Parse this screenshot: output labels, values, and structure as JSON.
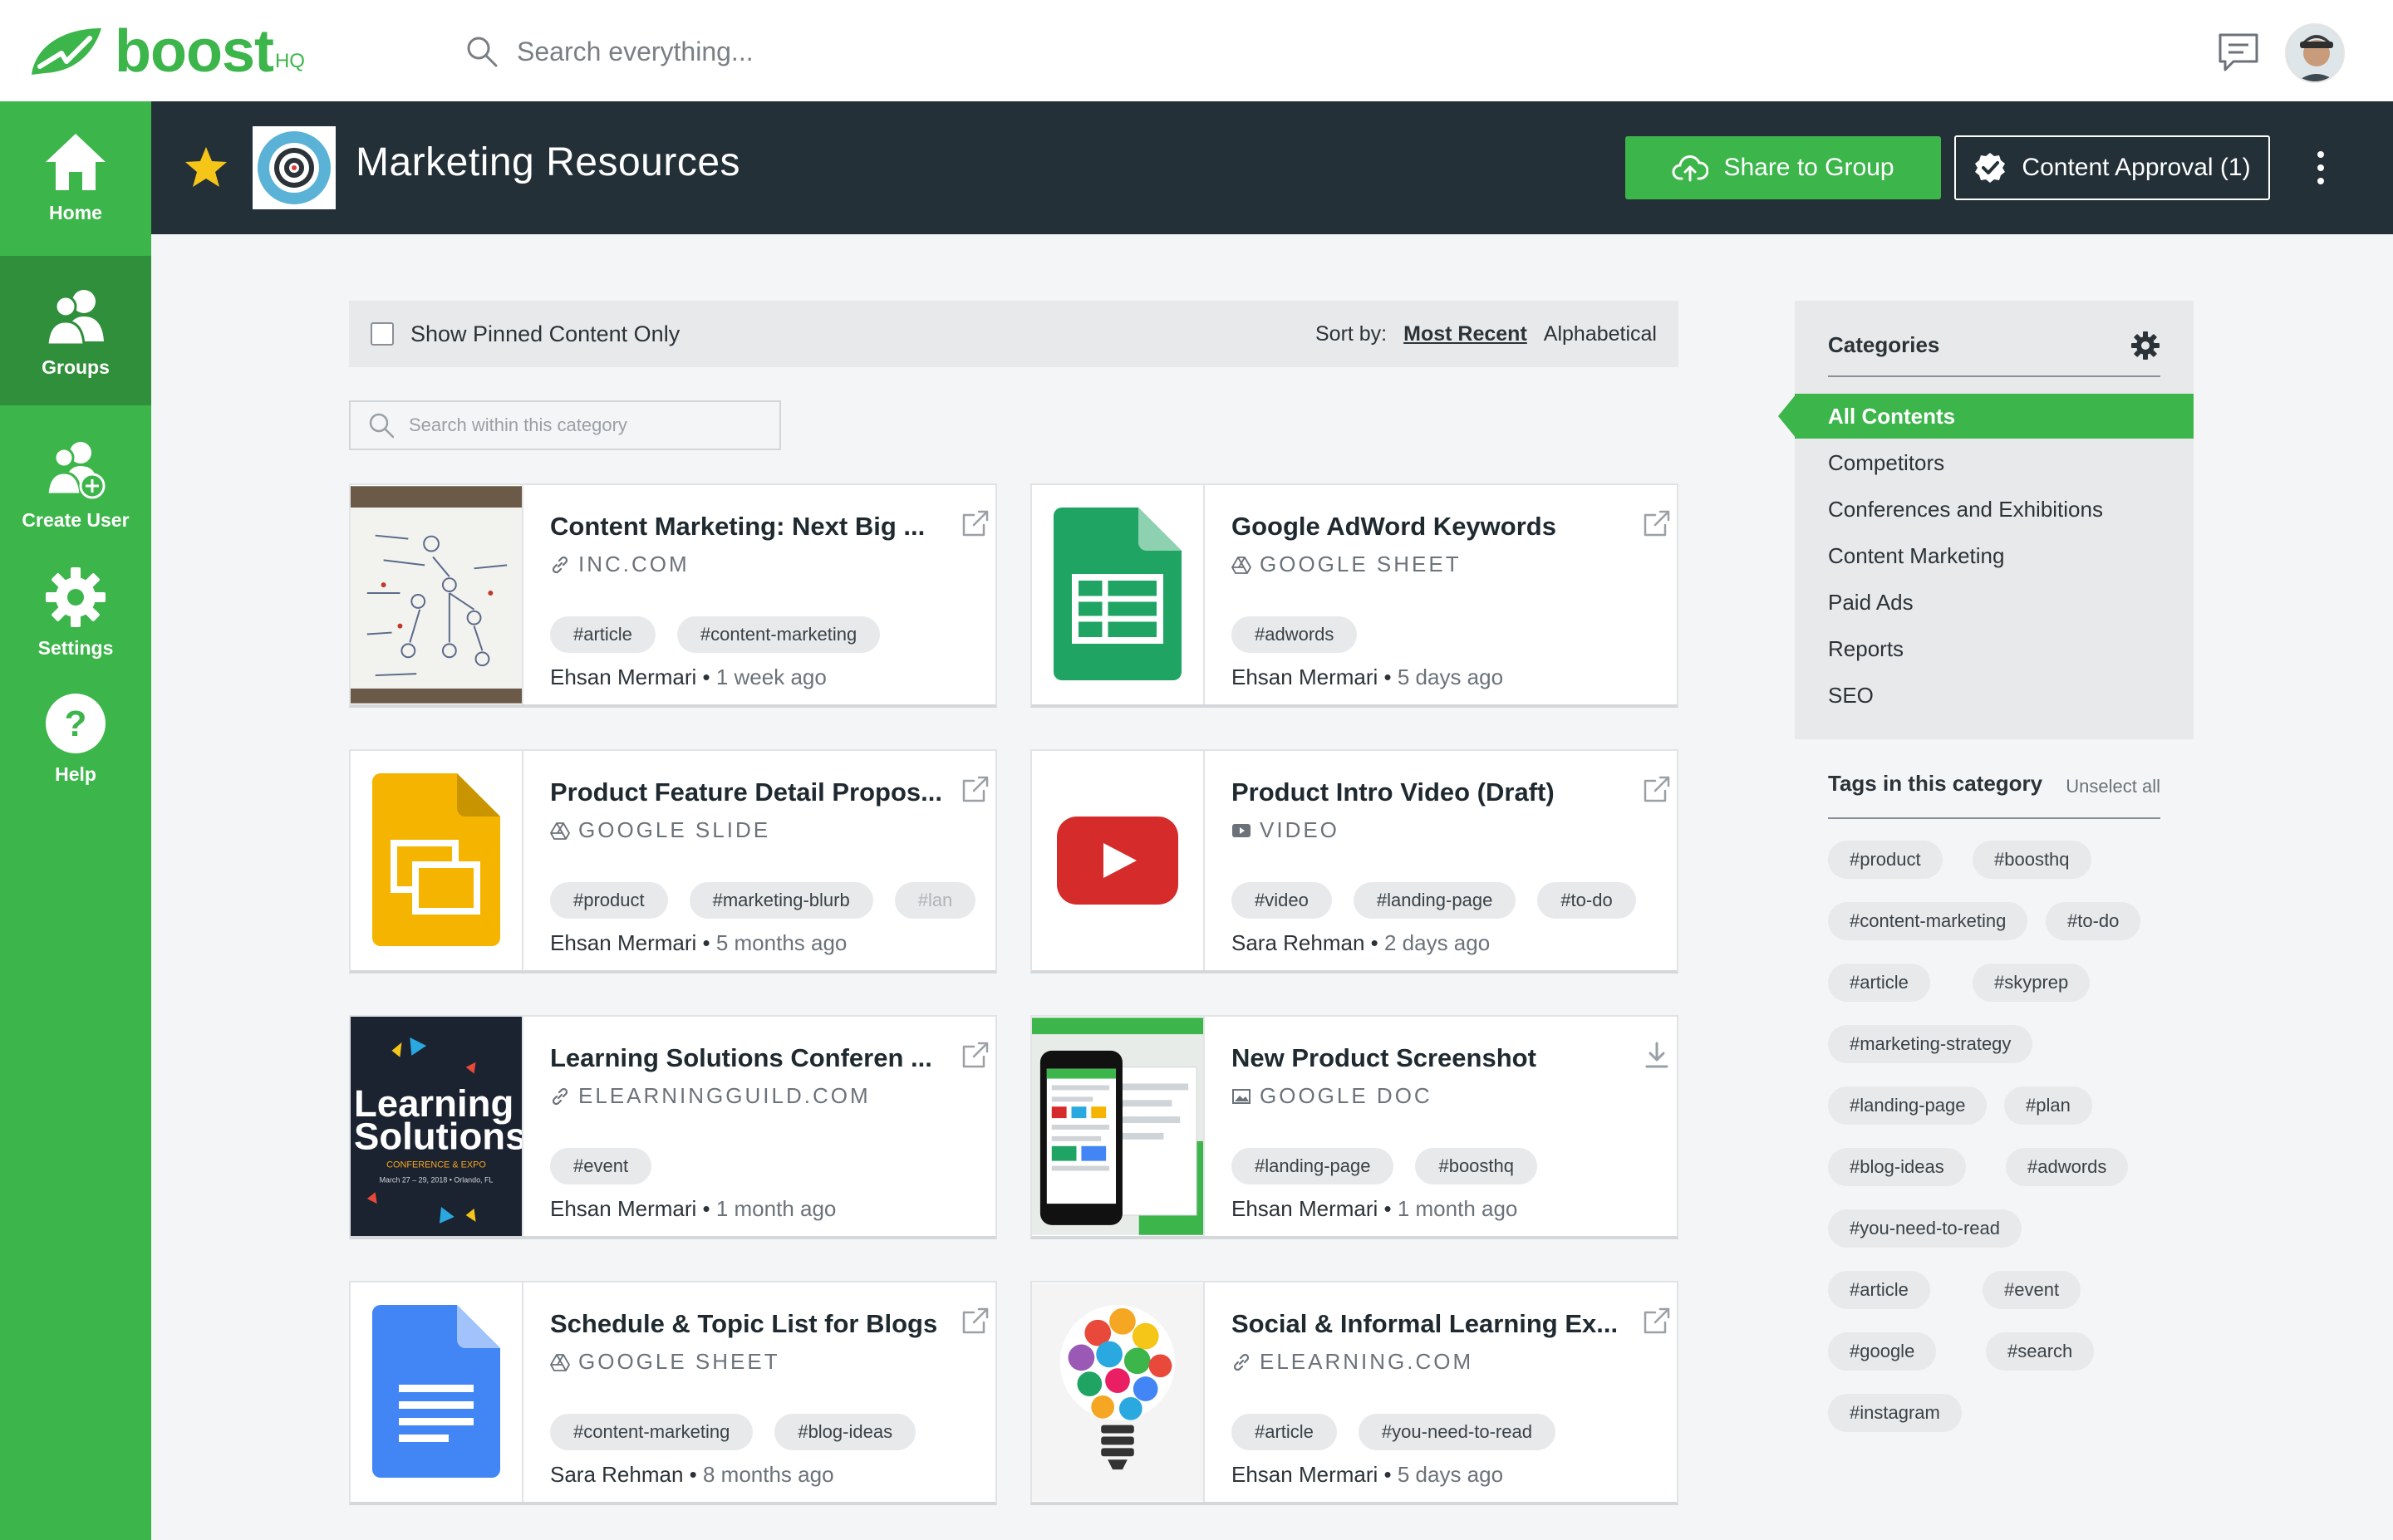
{
  "brand": {
    "name": "boost",
    "suffix": "HQ",
    "color": "#3cb54a"
  },
  "search": {
    "placeholder": "Search everything..."
  },
  "nav": {
    "home": "Home",
    "groups": "Groups",
    "create_user": "Create User",
    "settings": "Settings",
    "help": "Help"
  },
  "group": {
    "title": "Marketing Resources",
    "share_label": "Share to Group",
    "approval_label": "Content Approval (1)"
  },
  "filter": {
    "pinned_label": "Show Pinned Content Only",
    "sort_label": "Sort by:",
    "sort_recent": "Most Recent",
    "sort_alpha": "Alphabetical",
    "category_search_placeholder": "Search within this category"
  },
  "cards": [
    {
      "title": "Content Marketing: Next Big ...",
      "source": "INC.COM",
      "source_icon": "link-icon",
      "tags": [
        "#article",
        "#content-marketing"
      ],
      "author": "Ehsan Mermari",
      "ago": "1 week ago",
      "action": "external-link-icon"
    },
    {
      "title": "Google AdWord Keywords",
      "source": "GOOGLE SHEET",
      "source_icon": "google-drive-icon",
      "tags": [
        "#adwords"
      ],
      "author": "Ehsan Mermari",
      "ago": "5 days ago",
      "action": "external-link-icon"
    },
    {
      "title": "Product Feature Detail Propos...",
      "source": "GOOGLE SLIDE",
      "source_icon": "google-drive-icon",
      "tags": [
        "#product",
        "#marketing-blurb",
        "#lan"
      ],
      "author": "Ehsan Mermari",
      "ago": "5 months ago",
      "action": "external-link-icon"
    },
    {
      "title": "Product Intro Video (Draft)",
      "source": "VIDEO",
      "source_icon": "video-icon",
      "tags": [
        "#video",
        "#landing-page",
        "#to-do"
      ],
      "author": "Sara Rehman",
      "ago": "2 days ago",
      "action": "external-link-icon"
    },
    {
      "title": "Learning Solutions Conferen ...",
      "source": "ELEARNINGGUILD.COM",
      "source_icon": "link-icon",
      "tags": [
        "#event"
      ],
      "author": "Ehsan Mermari",
      "ago": "1 month ago",
      "action": "external-link-icon"
    },
    {
      "title": "New Product Screenshot",
      "source": "GOOGLE DOC",
      "source_icon": "image-icon",
      "tags": [
        "#landing-page",
        "#boosthq"
      ],
      "author": "Ehsan Mermari",
      "ago": "1 month ago",
      "action": "download-icon"
    },
    {
      "title": "Schedule & Topic List for Blogs",
      "source": "GOOGLE SHEET",
      "source_icon": "google-drive-icon",
      "tags": [
        "#content-marketing",
        "#blog-ideas"
      ],
      "author": "Sara Rehman",
      "ago": "8 months ago",
      "action": "external-link-icon"
    },
    {
      "title": "Social & Informal Learning Ex...",
      "source": "ELEARNING.COM",
      "source_icon": "link-icon",
      "tags": [
        "#article",
        "#you-need-to-read"
      ],
      "author": "Ehsan Mermari",
      "ago": "5 days ago",
      "action": "external-link-icon"
    }
  ],
  "thumb_text": {
    "learning": "Learning",
    "solutions": "Solutions",
    "conf": "CONFERENCE & EXPO",
    "dates": "March 27 – 29, 2018 • Orlando, FL"
  },
  "categories": {
    "title": "Categories",
    "items": [
      "All Contents",
      "Competitors",
      "Conferences and Exhibitions",
      "Content Marketing",
      "Paid Ads",
      "Reports",
      "SEO"
    ]
  },
  "tags_panel": {
    "title": "Tags in this category",
    "unselect": "Unselect all",
    "tags": [
      "#product",
      "#boosthq",
      "#content-marketing",
      "#to-do",
      "#article",
      "#skyprep",
      "#marketing-strategy",
      "#landing-page",
      "#plan",
      "#blog-ideas",
      "#adwords",
      "#you-need-to-read",
      "#article",
      "#event",
      "#google",
      "#search",
      "#instagram"
    ]
  }
}
